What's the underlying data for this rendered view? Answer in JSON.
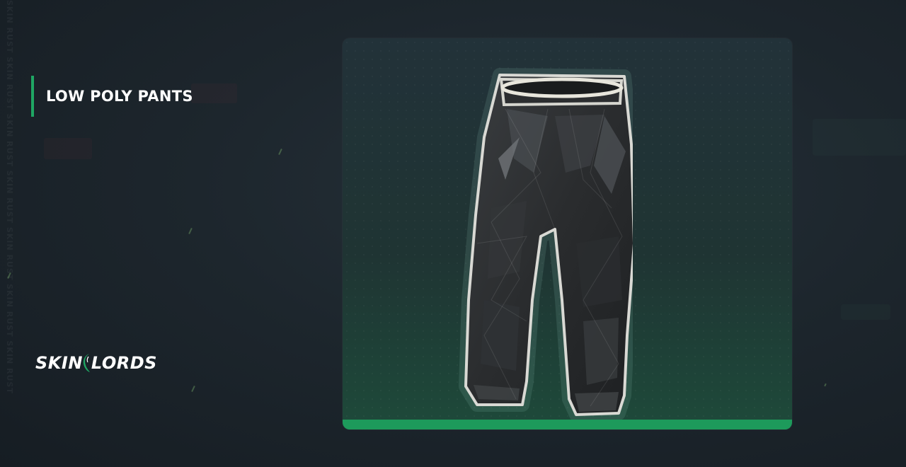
{
  "item": {
    "name": "LOW POLY PANTS"
  },
  "brand": {
    "logo_text_left": "SKIN",
    "logo_text_right": "LORDS"
  },
  "watermark": {
    "text": "SKIN RUST SKIN RUST SKIN RUST SKIN RUST SKIN RUST SKIN RUST SKIN RUST"
  },
  "colors": {
    "accent": "#1fa663",
    "card_bar": "#1d9a5b",
    "background": "#1d262d"
  },
  "icons": {
    "item_image": "pants-icon",
    "logo_mark": "dragon-icon"
  }
}
